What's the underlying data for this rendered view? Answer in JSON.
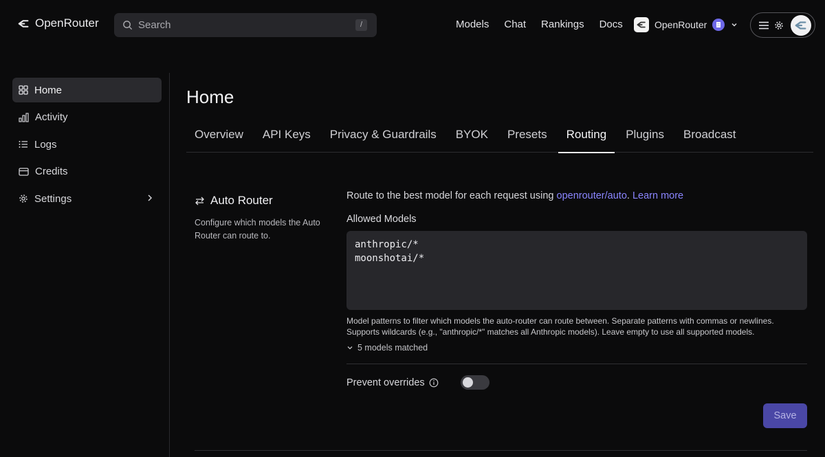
{
  "brand": {
    "name": "OpenRouter"
  },
  "search": {
    "placeholder": "Search",
    "shortcut": "/"
  },
  "nav": [
    "Models",
    "Chat",
    "Rankings",
    "Docs"
  ],
  "org": {
    "name": "OpenRouter"
  },
  "sidebar": {
    "items": [
      {
        "label": "Home",
        "icon": "grid-icon",
        "active": true
      },
      {
        "label": "Activity",
        "icon": "bar-chart-icon"
      },
      {
        "label": "Logs",
        "icon": "list-icon"
      },
      {
        "label": "Credits",
        "icon": "credit-card-icon"
      },
      {
        "label": "Settings",
        "icon": "gear-icon"
      }
    ]
  },
  "page": {
    "title": "Home"
  },
  "tabs": [
    "Overview",
    "API Keys",
    "Privacy & Guardrails",
    "BYOK",
    "Presets",
    "Routing",
    "Plugins",
    "Broadcast"
  ],
  "active_tab": "Routing",
  "auto_router": {
    "title": "Auto Router",
    "description": "Configure which models the Auto Router can route to.",
    "route_prefix": "Route to the best model for each request using ",
    "route_link": "openrouter/auto",
    "route_sep": ". ",
    "learn_more": "Learn more",
    "allowed_label": "Allowed Models",
    "allowed_models": "anthropic/*\nmoonshotai/*",
    "hint_line1": "Model patterns to filter which models the auto-router can route between. Separate patterns with commas or newlines.",
    "hint_line2": "Supports wildcards (e.g., \"anthropic/*\" matches all Anthropic models). Leave empty to use all supported models.",
    "matched": "5 models matched",
    "prevent_overrides": "Prevent overrides",
    "prevent_overrides_on": false,
    "save": "Save"
  },
  "colors": {
    "accent": "#8a85ff",
    "save_bg": "#4a47a6",
    "background": "#0b0b0c"
  }
}
